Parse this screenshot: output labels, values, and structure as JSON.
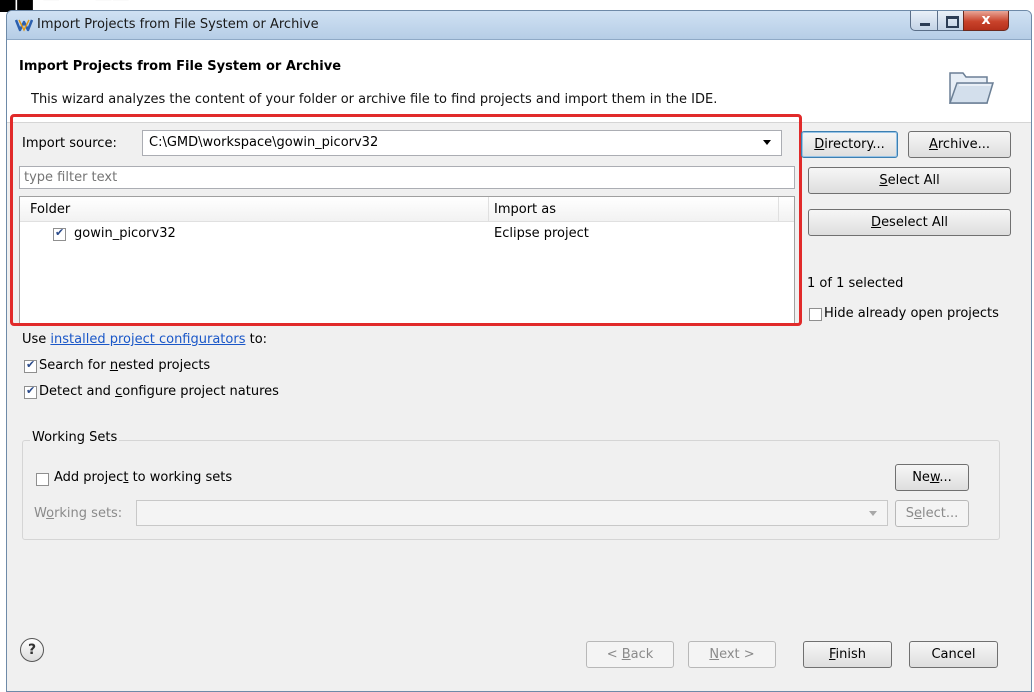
{
  "window": {
    "title": "Import Projects from File System or Archive",
    "close_glyph": "x"
  },
  "header": {
    "heading": "Import Projects from File System or Archive",
    "description": "This wizard analyzes the content of your folder or archive file to find projects and import them in the IDE.",
    "icon": "open-folder-icon"
  },
  "import_source": {
    "label": "Import source:",
    "value": "C:\\GMD\\workspace\\gowin_picorv32"
  },
  "filter": {
    "placeholder": "type filter text"
  },
  "table": {
    "columns": [
      "Folder",
      "Import as"
    ],
    "rows": [
      {
        "folder": "gowin_picorv32",
        "import_as": "Eclipse project",
        "checked": true
      }
    ]
  },
  "buttons": {
    "directory": "Directory...",
    "archive": "Archive...",
    "select_all": "Select All",
    "deselect_all": "Deselect All",
    "new": "New...",
    "select": "Select...",
    "back": "< Back",
    "next": "Next >",
    "finish": "Finish",
    "cancel": "Cancel"
  },
  "selection": {
    "count_text": "1 of 1 selected",
    "hide_open_label": "Hide already open projects",
    "hide_open_checked": false
  },
  "options": {
    "use_prefix": "Use ",
    "configurators_link": "installed project configurators",
    "use_suffix": " to:",
    "search_nested": "Search for nested projects",
    "search_nested_checked": true,
    "detect_natures": "Detect and configure project natures",
    "detect_natures_checked": true
  },
  "working_sets": {
    "title": "Working Sets",
    "add_label": "Add project to working sets",
    "add_checked": false,
    "sets_label": "Working sets:",
    "sets_value": ""
  },
  "colors": {
    "highlight": "#e12a2a",
    "link": "#1a57c8"
  }
}
